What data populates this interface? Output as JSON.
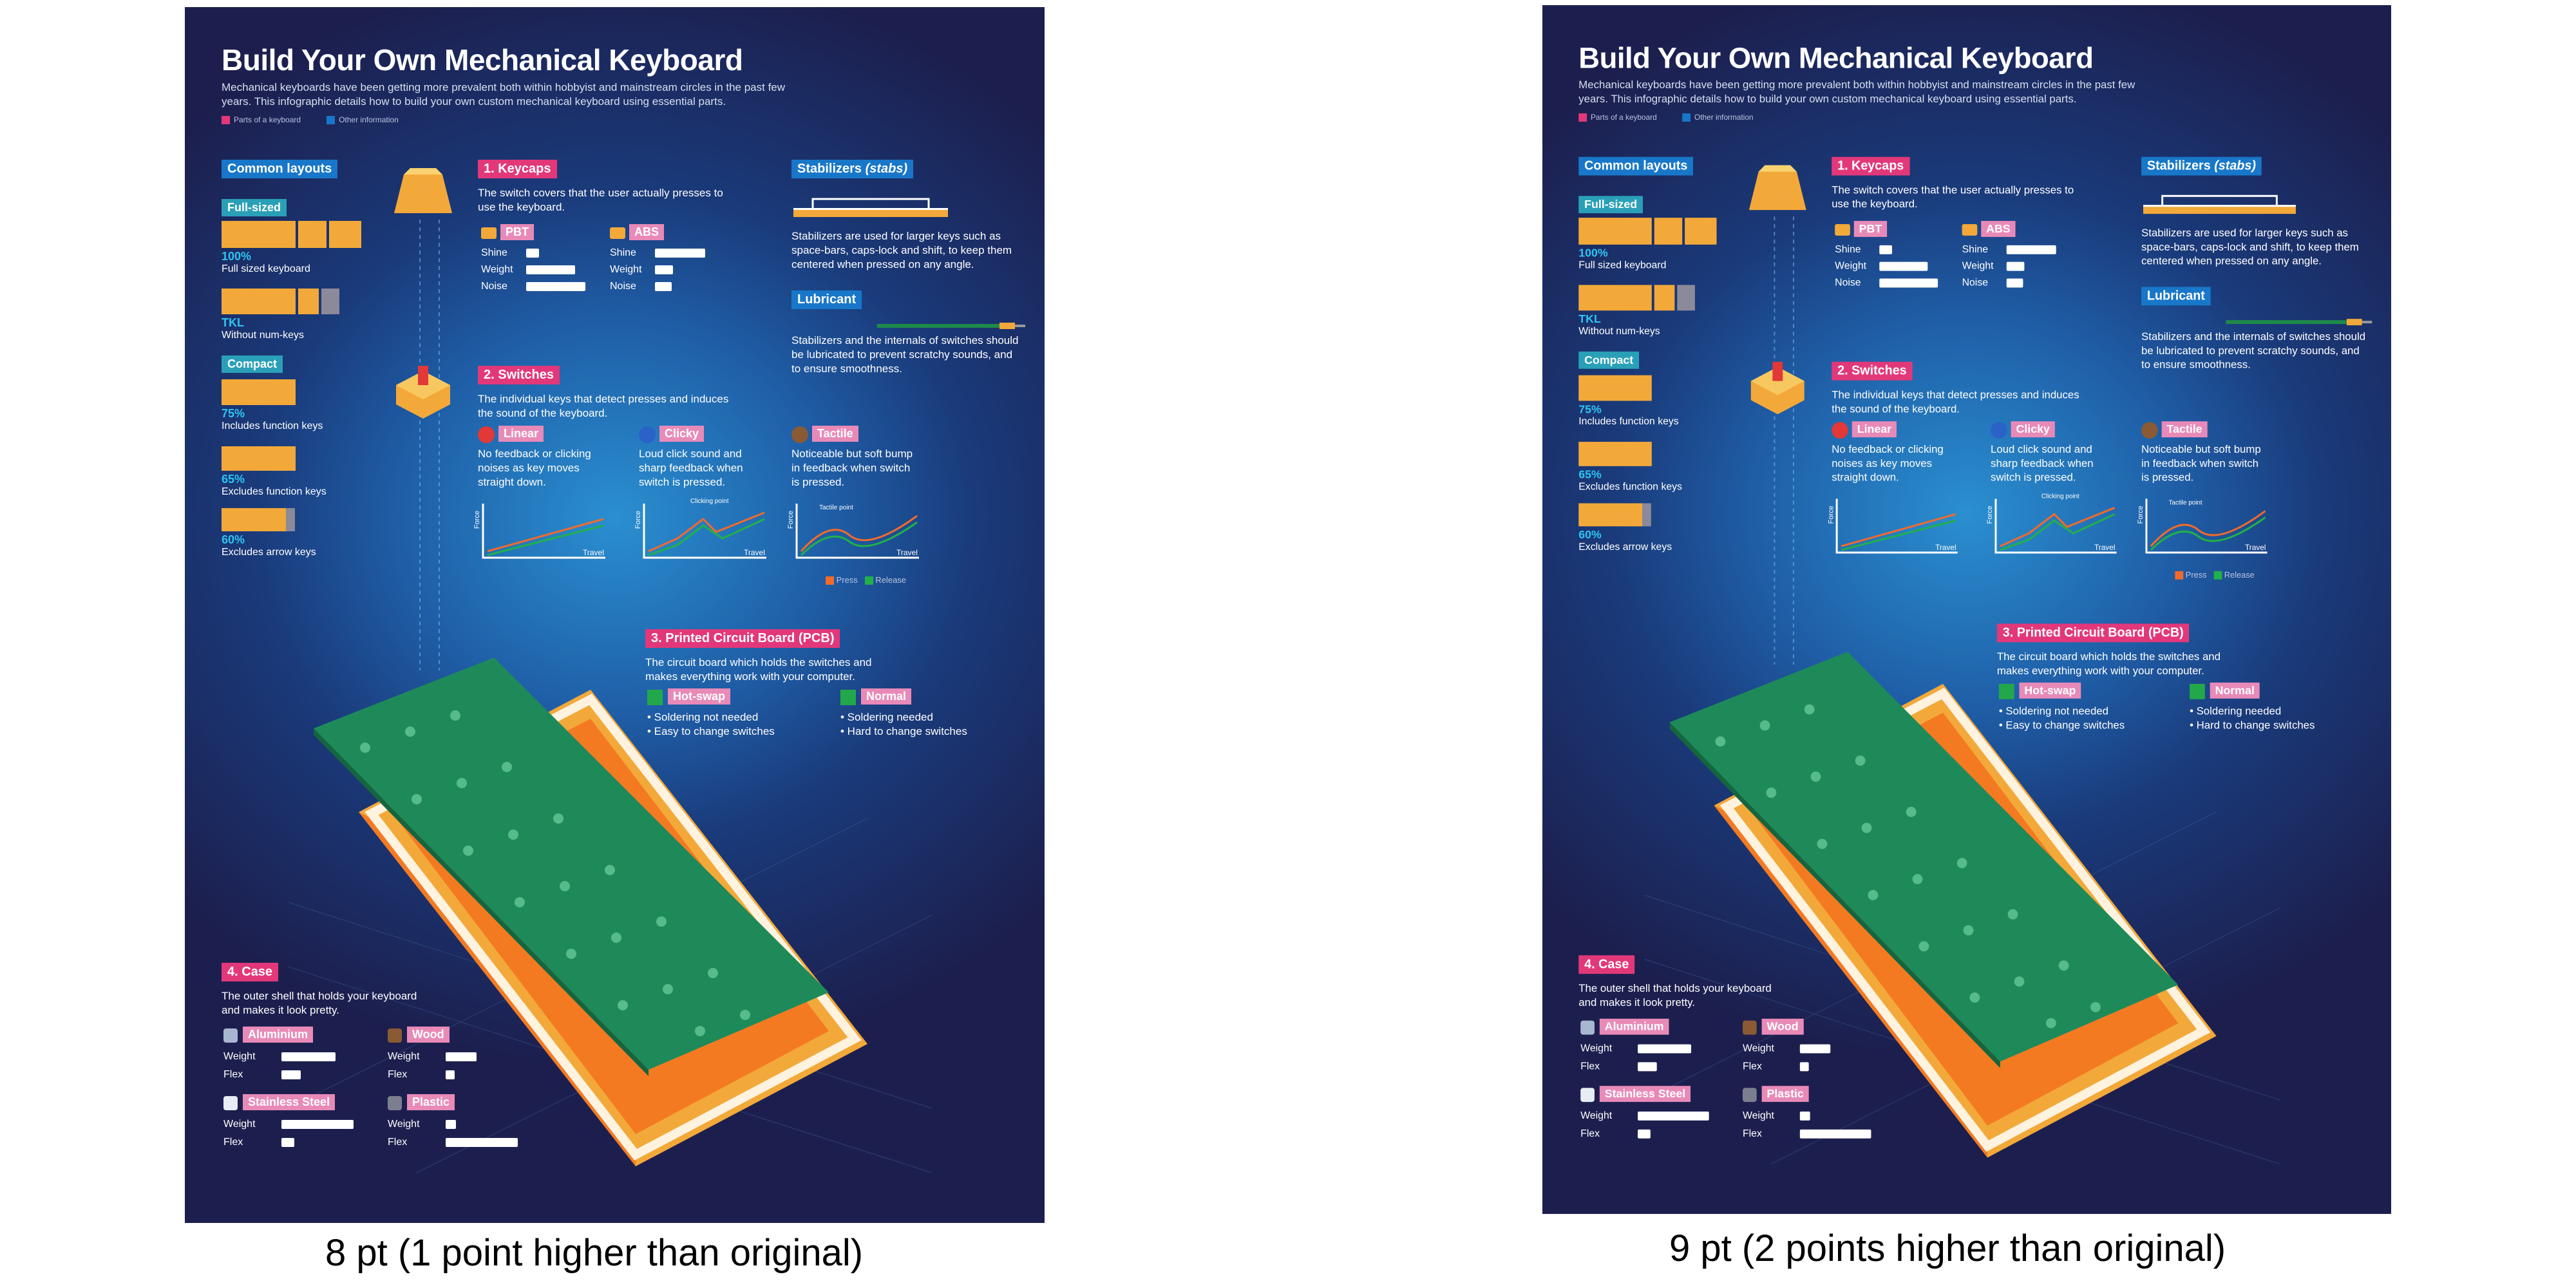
{
  "poster": {
    "title": "Build Your Own Mechanical Keyboard",
    "subtitle": "Mechanical keyboards have been getting more prevalent both within hobbyist and mainstream circles in the past few years. This infographic details how to build your own custom mechanical keyboard using essential parts.",
    "legend": [
      {
        "label": "Parts of a keyboard",
        "color": "#e2387a"
      },
      {
        "label": "Other information",
        "color": "#1877c8"
      }
    ],
    "layouts": {
      "heading": "Common layouts",
      "full_sized_tag": "Full-sized",
      "full_pct": "100%",
      "full_desc": "Full sized keyboard",
      "tkl_pct": "TKL",
      "tkl_desc": "Without num-keys",
      "compact_tag": "Compact",
      "c75_pct": "75%",
      "c75_desc": "Includes function keys",
      "c65_pct": "65%",
      "c65_desc": "Excludes function keys",
      "c60_pct": "60%",
      "c60_desc": "Excludes arrow keys"
    },
    "keycaps": {
      "heading": "1. Keycaps",
      "desc": "The switch covers that the user actually presses to use the keyboard.",
      "pbt": "PBT",
      "abs": "ABS",
      "shine": "Shine",
      "weight": "Weight",
      "noise": "Noise",
      "pbt_levels": {
        "shine": 0.15,
        "weight": 0.55,
        "noise": 0.65
      },
      "abs_levels": {
        "shine": 0.55,
        "weight": 0.2,
        "noise": 0.18
      }
    },
    "stabilizers": {
      "heading": "Stabilizers",
      "heading_em": "(stabs)",
      "desc": "Stabilizers are used for larger keys such as space-bars, caps-lock and shift, to keep them centered when pressed on any angle."
    },
    "lubricant": {
      "heading": "Lubricant",
      "desc": "Stabilizers and the internals of switches should be lubricated to prevent scratchy sounds, and to ensure smoothness."
    },
    "switches": {
      "heading": "2. Switches",
      "desc": "The individual keys that detect presses and induces the sound of the keyboard.",
      "types": [
        {
          "name": "Linear",
          "desc": "No feedback or clicking noises as key moves straight down.",
          "note": ""
        },
        {
          "name": "Clicky",
          "desc": "Loud click sound and sharp feedback when switch is pressed.",
          "note": "Clicking point"
        },
        {
          "name": "Tactile",
          "desc": "Noticeable but soft bump in feedback when switch is pressed.",
          "note": "Tactile point"
        }
      ],
      "axis_y": "Force",
      "axis_x": "Travel",
      "press_label": "Press",
      "release_label": "Release",
      "press_color": "#f26a2a",
      "release_color": "#22b04a"
    },
    "pcb": {
      "heading": "3. Printed Circuit Board (PCB)",
      "desc": "The circuit board which holds the switches and makes everything work with your computer.",
      "hotswap": "Hot-swap",
      "hotswap_points": [
        "• Soldering not needed",
        "• Easy to change switches"
      ],
      "normal": "Normal",
      "normal_points": [
        "• Soldering needed",
        "• Hard to change switches"
      ]
    },
    "case": {
      "heading": "4. Case",
      "desc": "The outer shell that holds your keyboard and makes it look pretty.",
      "weight": "Weight",
      "flex": "Flex",
      "materials": [
        {
          "name": "Aluminium",
          "weight": 0.6,
          "flex": 0.22,
          "color": "#a9b6d2"
        },
        {
          "name": "Wood",
          "weight": 0.35,
          "flex": 0.1,
          "color": "#8a5a34"
        },
        {
          "name": "Stainless Steel",
          "weight": 0.8,
          "flex": 0.15,
          "color": "#e8ecf4"
        },
        {
          "name": "Plastic",
          "weight": 0.12,
          "flex": 0.8,
          "color": "#7c7f90"
        }
      ]
    }
  },
  "captions": {
    "left": "8 pt (1 point higher than original)",
    "right": "9 pt (2 points higher than original)"
  }
}
